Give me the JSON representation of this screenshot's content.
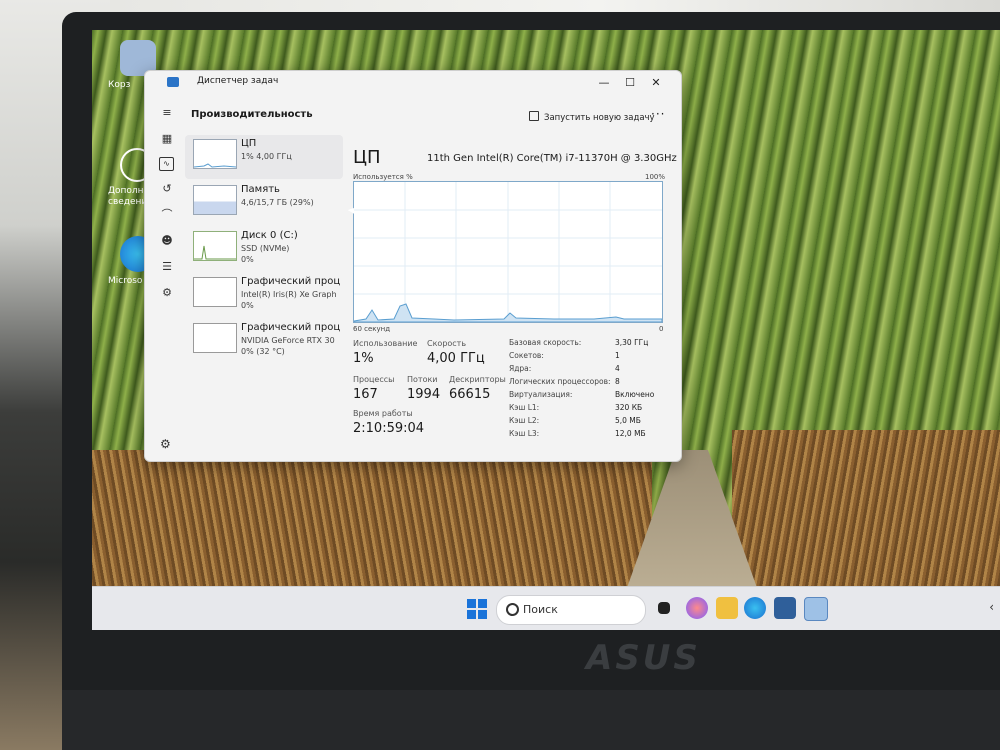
{
  "window": {
    "title": "Диспетчер задач",
    "page_heading": "Производительность",
    "new_task_label": "Запустить новую задачу",
    "more_label": "···",
    "controls": {
      "minimize": "—",
      "maximize": "☐",
      "close": "✕"
    }
  },
  "sidebar_icons": [
    "menu-icon",
    "processes-icon",
    "performance-icon",
    "history-icon",
    "startup-icon",
    "users-icon",
    "details-icon",
    "services-icon",
    "settings-icon"
  ],
  "panes": [
    {
      "name": "ЦП",
      "sub": "1% 4,00 ГГц",
      "sub2": "",
      "selected": true
    },
    {
      "name": "Память",
      "sub": "4,6/15,7 ГБ (29%)",
      "sub2": "",
      "selected": false
    },
    {
      "name": "Диск 0 (C:)",
      "sub": "SSD (NVMe)",
      "sub2": "0%",
      "selected": false
    },
    {
      "name": "Графический проц",
      "sub": "Intel(R) Iris(R) Xe Graph",
      "sub2": "0%",
      "selected": false
    },
    {
      "name": "Графический проц",
      "sub": "NVIDIA GeForce RTX 30",
      "sub2": "0% (32 °C)",
      "selected": false
    }
  ],
  "cpu": {
    "title": "ЦП",
    "model": "11th Gen Intel(R) Core(TM) i7-11370H @ 3.30GHz",
    "graph_label_left": "Используется %",
    "graph_label_right": "100%",
    "graph_foot_left": "60 секунд",
    "graph_foot_right": "0",
    "usage_label": "Использование",
    "usage_value": "1%",
    "speed_label": "Скорость",
    "speed_value": "4,00 ГГц",
    "processes_label": "Процессы",
    "processes_value": "167",
    "threads_label": "Потоки",
    "threads_value": "1994",
    "handles_label": "Дескрипторы",
    "handles_value": "66615",
    "uptime_label": "Время работы",
    "uptime_value": "2:10:59:04",
    "details": [
      {
        "k": "Базовая скорость:",
        "v": "3,30 ГГц"
      },
      {
        "k": "Сокетов:",
        "v": "1"
      },
      {
        "k": "Ядра:",
        "v": "4"
      },
      {
        "k": "Логических процессоров:",
        "v": "8"
      },
      {
        "k": "Виртуализация:",
        "v": "Включено"
      },
      {
        "k": "Кэш L1:",
        "v": "320 КБ"
      },
      {
        "k": "Кэш L2:",
        "v": "5,0 МБ"
      },
      {
        "k": "Кэш L3:",
        "v": "12,0 МБ"
      }
    ]
  },
  "desktop": {
    "icons": [
      {
        "label": "Корз"
      },
      {
        "label": "Дополни сведения"
      },
      {
        "label": "Microso"
      }
    ]
  },
  "taskbar": {
    "search_label": "Поиск",
    "chevron": "‹"
  },
  "bezel": {
    "brand": "ASUS"
  },
  "colors": {
    "accent": "#2b74c7",
    "graph_line": "#5a9ed0",
    "graph_fill": "#cfe3f3"
  }
}
